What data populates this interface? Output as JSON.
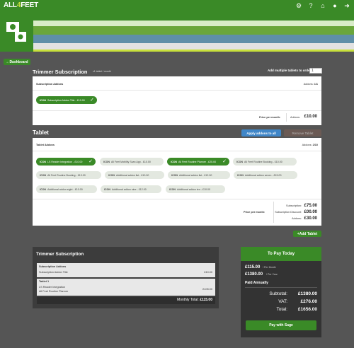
{
  "header": {
    "logo_prefix": "ALL",
    "logo_four": "4",
    "logo_suffix": "FEET"
  },
  "nav": {
    "dashboard": "Dashboard"
  },
  "trimmer": {
    "title": "Trimmer Subscription",
    "subtitle": "x1 tablet / month",
    "multi_label": "Add multiple tablets to order",
    "multi_value": "1",
    "addons_header": "Subscription Addons",
    "addons_count_label": "Addons:",
    "addons_count": "1/1",
    "addon": {
      "tag": "ICON",
      "label": "Subscription Addon Title - £10.00"
    },
    "price_label": "Price per month:",
    "addon_total_label": "Addons:",
    "addon_total": "£10.00"
  },
  "tablet": {
    "title": "Tablet",
    "apply_btn": "Apply addons to all",
    "remove_btn": "Remove Tablet",
    "addons_header": "Tablet Addons",
    "addons_count_label": "Addons:",
    "addons_count": "2/10",
    "addons": [
      {
        "tag": "ICON",
        "label": "LS Reader Integration - £10.00",
        "on": true
      },
      {
        "tag": "ICON",
        "label": "All Feet Mobility Scan App - £10.00",
        "on": false
      },
      {
        "tag": "ICON",
        "label": "All Feet Routine Planner - £25.00",
        "on": true
      },
      {
        "tag": "ICON",
        "label": "All Feet Routine Booking - £10.00",
        "on": false
      },
      {
        "tag": "ICON",
        "label": "All Feet Routine Booking - £13.00",
        "on": false
      },
      {
        "tag": "ICON",
        "label": "Additional addon list - £10.00",
        "on": false
      },
      {
        "tag": "ICON",
        "label": "Additional addon list - £12.00",
        "on": false
      },
      {
        "tag": "ICON",
        "label": "Additional addon seven - £15.00",
        "on": false
      },
      {
        "tag": "ICON",
        "label": "Additional addon eight - £10.00",
        "on": false
      },
      {
        "tag": "ICON",
        "label": "Additional addon nine - £12.00",
        "on": false
      },
      {
        "tag": "ICON",
        "label": "Additional addon ten - £10.00",
        "on": false
      }
    ],
    "price_label": "Price per month:",
    "rows": [
      {
        "label": "Subscription:",
        "value": "£75.00"
      },
      {
        "label": "Subscription Discount:",
        "value": "£00.00"
      },
      {
        "label": "Addons:",
        "value": "£30.00"
      }
    ],
    "add_btn": "Add Tablet"
  },
  "summary": {
    "title": "Trimmer Subscription",
    "sub_header": "Subscription Addons",
    "sub_item": "Subscription Addon Title",
    "sub_price": "£10.00",
    "tablet_header": "Tablet 1",
    "tablet_item1": "LS Reader Integration",
    "tablet_item2": "All Feet Routine Planner",
    "tablet_price": "£105.00",
    "monthly_label": "Monthly Total:",
    "monthly_value": "£115.00"
  },
  "pay": {
    "title": "To Pay Today",
    "line1_amount": "£115.00",
    "line1_label": "/ Per Month",
    "line2_amount": "£1380.00",
    "line2_label": "/ Per Year",
    "period": "Paid Annually",
    "subtotal_label": "Subtotal:",
    "subtotal": "£1380.00",
    "vat_label": "VAT:",
    "vat": "£276.00",
    "total_label": "Total:",
    "total": "£1656.00",
    "btn": "Pay with Sage"
  },
  "colors": {
    "brand_green": "#3a8a27",
    "accent_lime": "#c8e03c",
    "apply_blue": "#3f86c8",
    "background": "#555555"
  }
}
